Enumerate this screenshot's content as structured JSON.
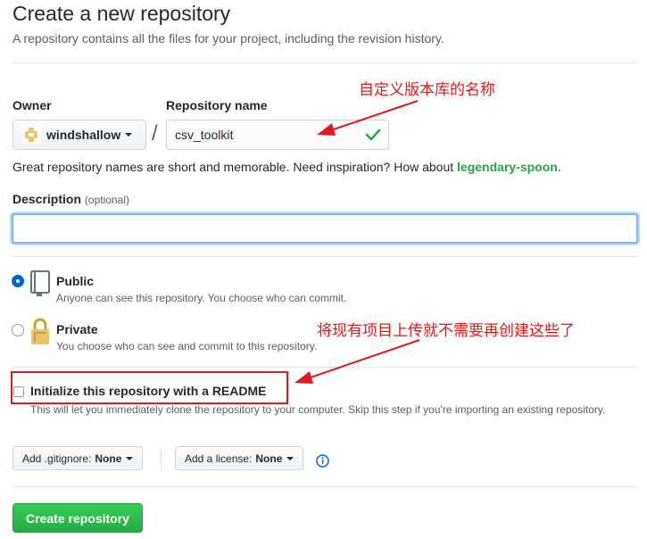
{
  "page": {
    "title": "Create a new repository",
    "subtitle": "A repository contains all the files for your project, including the revision history."
  },
  "owner": {
    "label": "Owner",
    "value": "windshallow"
  },
  "repo": {
    "label": "Repository name",
    "value": "csv_toolkit"
  },
  "hint": {
    "text": "Great repository names are short and memorable. Need inspiration? How about ",
    "suggestion": "legendary-spoon",
    "end": "."
  },
  "description": {
    "label": "Description",
    "optional": "(optional)",
    "value": ""
  },
  "visibility": {
    "public": {
      "title": "Public",
      "desc": "Anyone can see this repository. You choose who can commit.",
      "selected": true
    },
    "private": {
      "title": "Private",
      "desc": "You choose who can see and commit to this repository.",
      "selected": false
    }
  },
  "init": {
    "label": "Initialize this repository with a README",
    "desc": "This will let you immediately clone the repository to your computer. Skip this step if you're importing an existing repository.",
    "checked": false
  },
  "gitignore": {
    "label": "Add .gitignore:",
    "value": "None"
  },
  "license": {
    "label": "Add a license:",
    "value": "None"
  },
  "create_button": "Create repository",
  "annotations": {
    "repo_name": "自定义版本库的名称",
    "readme": "将现有项目上传就不需要再创建这些了"
  },
  "colors": {
    "accent_blue": "#0366d6",
    "success_green": "#28a745",
    "annotation_red": "#e0191c"
  },
  "icons": [
    "owner-avatar-icon",
    "check-icon",
    "public-repo-icon",
    "private-lock-icon",
    "info-icon",
    "caret-down-icon"
  ]
}
